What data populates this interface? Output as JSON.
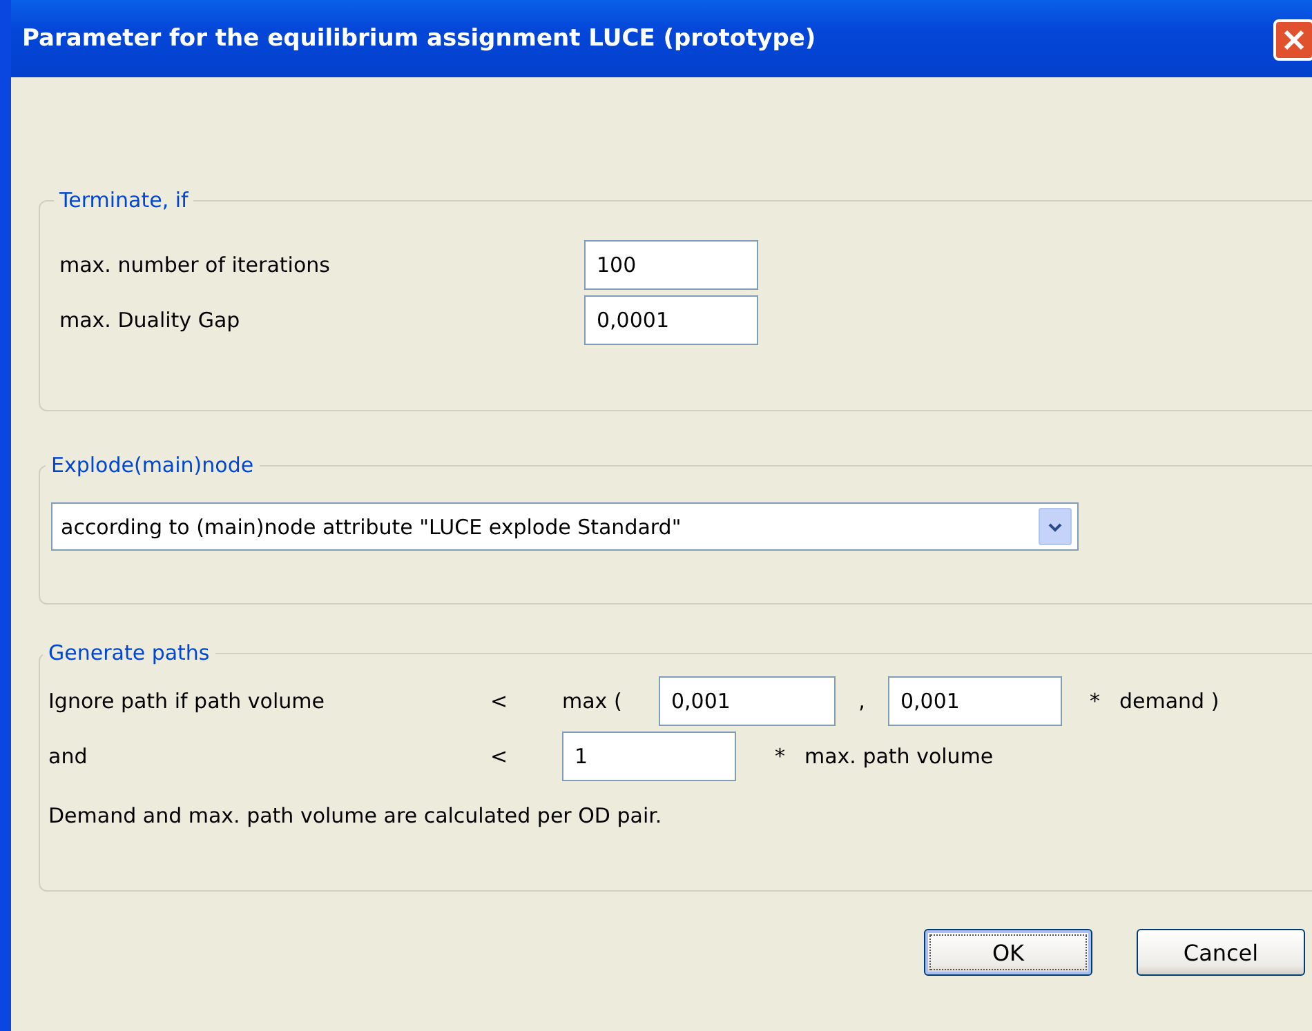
{
  "window": {
    "title": "Parameter for the equilibrium assignment LUCE (prototype)"
  },
  "terminate": {
    "title": "Terminate, if",
    "fields": [
      {
        "label": "max. number of iterations",
        "value": "100"
      },
      {
        "label": "max. Duality Gap",
        "value": "0,0001"
      }
    ]
  },
  "explode": {
    "title": "Explode(main)node",
    "selection": "according to (main)node attribute \"LUCE explode Standard\""
  },
  "generate_paths": {
    "title": "Generate paths",
    "row_1": {
      "label": "Ignore path if path volume",
      "operator": "<",
      "function": "max (",
      "value_1": "0,001",
      "separator": ",",
      "value_2": "0,001",
      "multiplier": "*",
      "factor": "demand )"
    },
    "row_2": {
      "label": "and",
      "operator": "<",
      "value": "1",
      "multiplier": "*",
      "factor": "max. path volume"
    },
    "note": "Demand and max. path volume are calculated per OD pair."
  },
  "buttons": [
    {
      "label": "OK",
      "focused": true
    },
    {
      "label": "Cancel",
      "focused": false
    }
  ]
}
